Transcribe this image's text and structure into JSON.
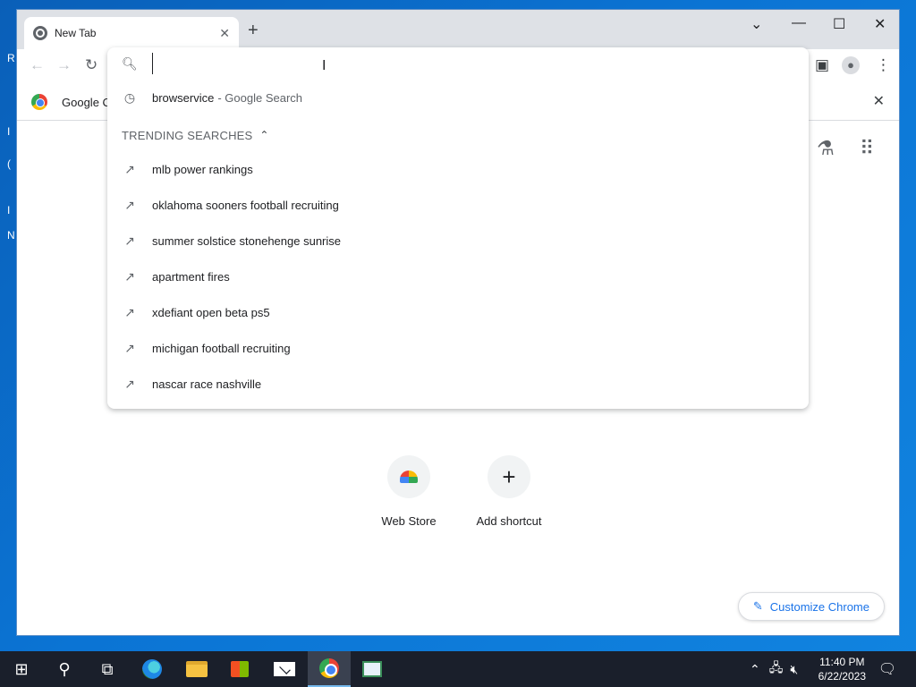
{
  "browser": {
    "tab_title": "New Tab",
    "bookmark_label": "Google C"
  },
  "omnibox": {
    "value": "",
    "suggestions": [
      {
        "text": "browservice",
        "subtext": "- Google Search",
        "icon": "history-icon"
      }
    ],
    "trending_header": "TRENDING SEARCHES",
    "trending": [
      "mlb power rankings",
      "oklahoma sooners football recruiting",
      "summer solstice stonehenge sunrise",
      "apartment fires",
      "xdefiant open beta ps5",
      "michigan football recruiting",
      "nascar race nashville"
    ]
  },
  "newtab": {
    "shortcuts": [
      {
        "label": "Web Store",
        "icon": "webstore-icon"
      },
      {
        "label": "Add shortcut",
        "icon": "plus-icon"
      }
    ],
    "customize_label": "Customize Chrome"
  },
  "desktop": {
    "fragments": [
      "R",
      "I",
      "(",
      "I",
      "N"
    ]
  },
  "taskbar": {
    "time": "11:40 PM",
    "date": "6/22/2023"
  },
  "colors": {
    "accent": "#1a73e8",
    "desktop": "#0b74d4",
    "taskbar": "#1a1f2b"
  }
}
